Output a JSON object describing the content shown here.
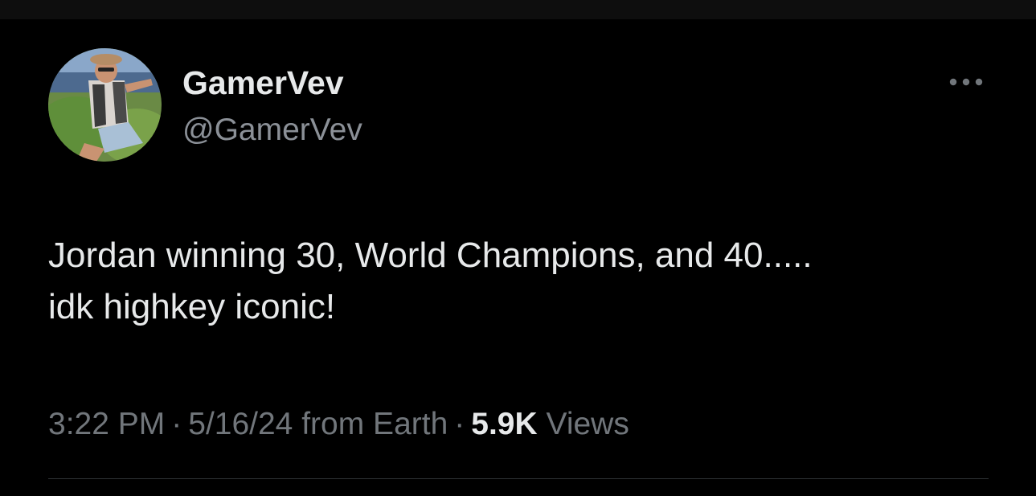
{
  "tweet": {
    "author": {
      "display_name": "GamerVev",
      "handle": "@GamerVev",
      "avatar_icon": "profile-photo"
    },
    "more_icon": "more-horizontal-icon",
    "text_lines": [
      "Jordan winning 30, World Champions, and 40.....",
      "idk highkey iconic!"
    ],
    "meta": {
      "time": "3:22 PM",
      "separator": "·",
      "date": "5/16/24",
      "source": "from Earth",
      "views_count": "5.9K",
      "views_label": "Views"
    }
  },
  "colors": {
    "background": "#000000",
    "primary_text": "#e7e9ea",
    "secondary_text": "#71767b",
    "divider": "#2f3336"
  }
}
